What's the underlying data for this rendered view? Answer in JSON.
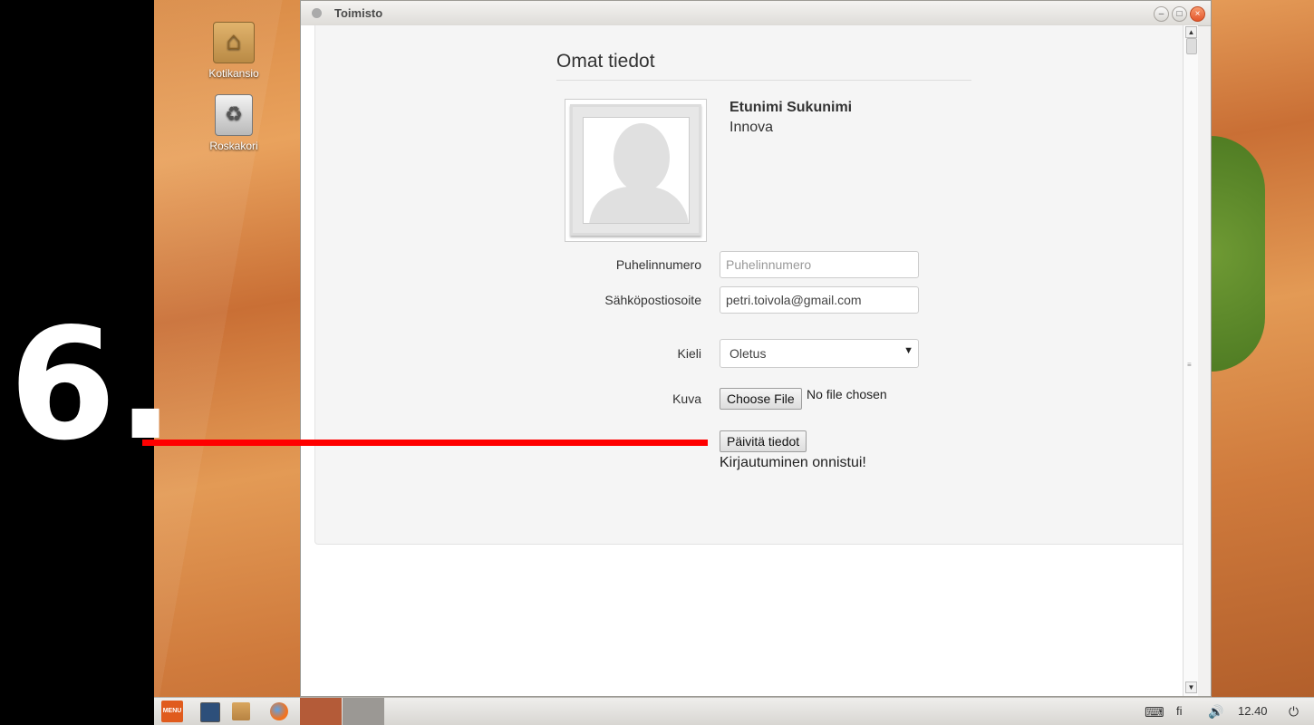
{
  "overlay": {
    "step_number": "6."
  },
  "desktop": {
    "icons": [
      {
        "label": "Kotikansio",
        "icon": "home-folder-icon"
      },
      {
        "label": "Roskakori",
        "icon": "trash-icon"
      }
    ]
  },
  "window": {
    "title": "Toimisto",
    "controls": {
      "minimize": "–",
      "maximize": "□",
      "close": "×"
    }
  },
  "profile": {
    "page_title": "Omat tiedot",
    "user_name": "Etunimi Sukunimi",
    "organization": "Innova",
    "fields": {
      "phone": {
        "label": "Puhelinnumero",
        "value": "",
        "placeholder": "Puhelinnumero"
      },
      "email": {
        "label": "Sähköpostiosoite",
        "value": "petri.toivola@gmail.com"
      },
      "language": {
        "label": "Kieli",
        "value": "Oletus"
      },
      "picture": {
        "label": "Kuva",
        "button": "Choose File",
        "status": "No file chosen"
      }
    },
    "submit_label": "Päivitä tiedot",
    "status_message": "Kirjautuminen onnistui!"
  },
  "taskbar": {
    "menu_label": "MENU",
    "keyboard_layout": "fi",
    "clock": "12.40"
  },
  "colors": {
    "annotation_line": "#ff0000",
    "close_button": "#e4562c",
    "menu_button": "#e05b1d"
  }
}
